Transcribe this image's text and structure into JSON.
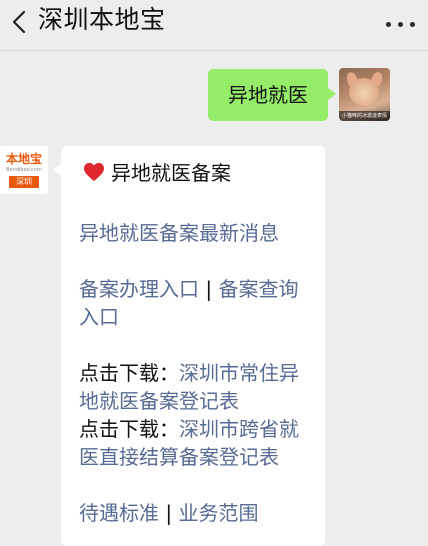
{
  "header": {
    "title": "深圳本地宝",
    "back_icon": "chevron-left-icon",
    "more_icon": "more-dots-icon"
  },
  "outgoing": {
    "text": "异地就医",
    "avatar_caption": "小猫咪的冰激凌表情"
  },
  "incoming": {
    "avatar_logo": "本地宝",
    "avatar_logo_sub": "Bendibao.com",
    "avatar_logo_tag": "深圳",
    "heading": "异地就医备案",
    "heading_icon": "red-heart-icon",
    "links": {
      "latest_news": "异地就医备案最新消息",
      "apply_entry": "备案办理入口",
      "separator1": "|",
      "query_entry_part1": "备案查询",
      "query_entry_part2": "入口",
      "download_label_1": "点击下载：",
      "download_1_part1": "深圳市常住异",
      "download_1_part2": "地就医备案登记表",
      "download_label_2": "点击下载：",
      "download_2_part1": "深圳市跨省就",
      "download_2_part2": "医直接结算备案登记表",
      "benefits": "待遇标准",
      "separator2": "|",
      "scope": "业务范围"
    }
  },
  "colors": {
    "background": "#ededed",
    "outgoing_bubble": "#95ec69",
    "incoming_bubble": "#ffffff",
    "link": "#576b95",
    "brand_orange": "#e8590c",
    "heart": "#e0262f"
  }
}
